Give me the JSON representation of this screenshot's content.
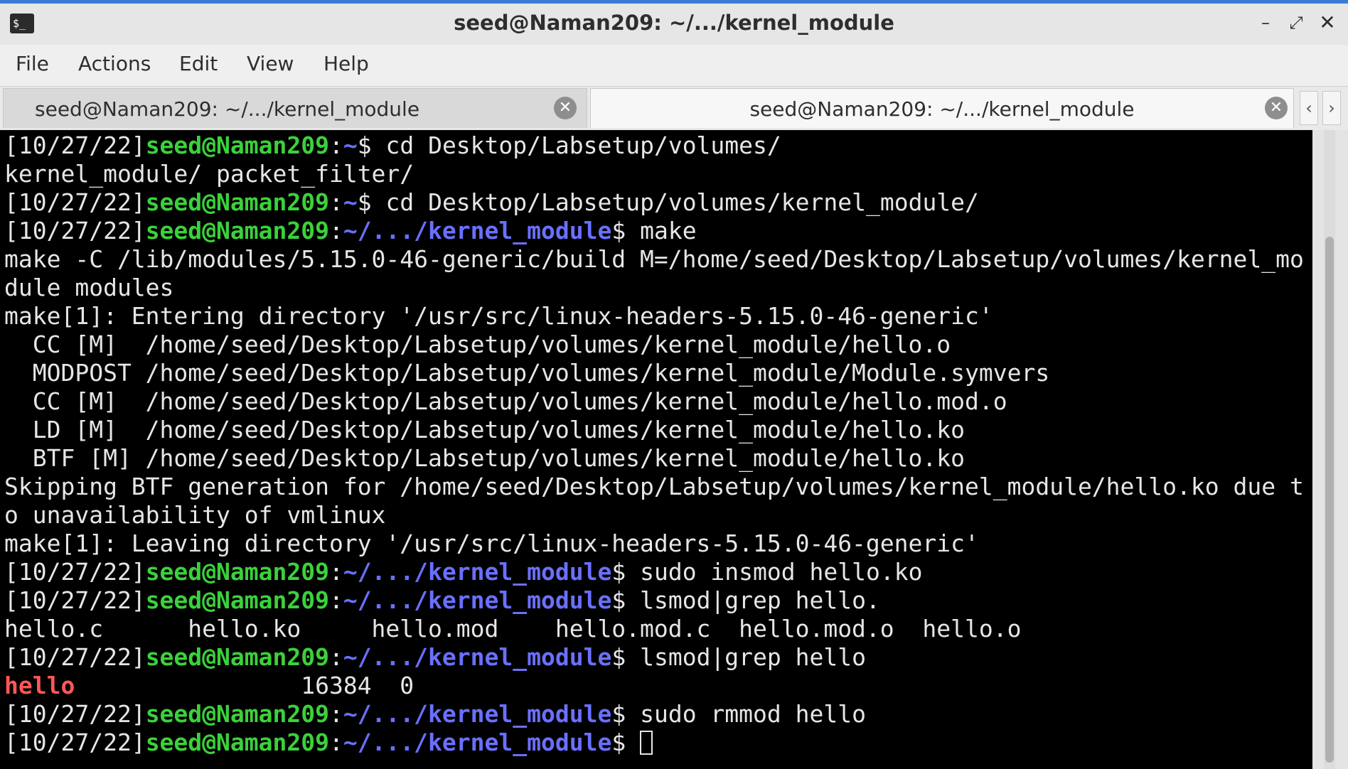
{
  "window": {
    "title": "seed@Naman209: ~/.../kernel_module",
    "app_icon": "$_",
    "controls": {
      "minimize": "–",
      "maximize": "⤢",
      "close": "✕"
    }
  },
  "menu": [
    "File",
    "Actions",
    "Edit",
    "View",
    "Help"
  ],
  "tabs": [
    {
      "label": "seed@Naman209: ~/.../kernel_module",
      "active": false
    },
    {
      "label": "seed@Naman209: ~/.../kernel_module",
      "active": true
    }
  ],
  "tab_nav": {
    "prev": "‹",
    "next": "›"
  },
  "terminal": {
    "prompt": {
      "date": "[10/27/22]",
      "user": "seed@Naman209",
      "home": "~",
      "path": "~/.../kernel_module"
    },
    "lines": [
      {
        "kind": "prompt_home",
        "cmd": "cd Desktop/Labsetup/volumes/"
      },
      {
        "kind": "out",
        "text": "kernel_module/ packet_filter/"
      },
      {
        "kind": "prompt_home",
        "cmd": "cd Desktop/Labsetup/volumes/kernel_module/"
      },
      {
        "kind": "prompt",
        "cmd": "make"
      },
      {
        "kind": "out",
        "text": "make -C /lib/modules/5.15.0-46-generic/build M=/home/seed/Desktop/Labsetup/volumes/kernel_mo"
      },
      {
        "kind": "out",
        "text": "dule modules"
      },
      {
        "kind": "out",
        "text": "make[1]: Entering directory '/usr/src/linux-headers-5.15.0-46-generic'"
      },
      {
        "kind": "out",
        "text": "  CC [M]  /home/seed/Desktop/Labsetup/volumes/kernel_module/hello.o"
      },
      {
        "kind": "out",
        "text": "  MODPOST /home/seed/Desktop/Labsetup/volumes/kernel_module/Module.symvers"
      },
      {
        "kind": "out",
        "text": "  CC [M]  /home/seed/Desktop/Labsetup/volumes/kernel_module/hello.mod.o"
      },
      {
        "kind": "out",
        "text": "  LD [M]  /home/seed/Desktop/Labsetup/volumes/kernel_module/hello.ko"
      },
      {
        "kind": "out",
        "text": "  BTF [M] /home/seed/Desktop/Labsetup/volumes/kernel_module/hello.ko"
      },
      {
        "kind": "out",
        "text": "Skipping BTF generation for /home/seed/Desktop/Labsetup/volumes/kernel_module/hello.ko due t"
      },
      {
        "kind": "out",
        "text": "o unavailability of vmlinux"
      },
      {
        "kind": "out",
        "text": "make[1]: Leaving directory '/usr/src/linux-headers-5.15.0-46-generic'"
      },
      {
        "kind": "prompt",
        "cmd": "sudo insmod hello.ko"
      },
      {
        "kind": "prompt",
        "cmd": "lsmod|grep hello."
      },
      {
        "kind": "out",
        "text": "hello.c      hello.ko     hello.mod    hello.mod.c  hello.mod.o  hello.o"
      },
      {
        "kind": "prompt",
        "cmd": "lsmod|grep hello"
      },
      {
        "kind": "lsmod",
        "name": "hello",
        "rest": "                16384  0"
      },
      {
        "kind": "prompt",
        "cmd": "sudo rmmod hello"
      },
      {
        "kind": "prompt_cursor",
        "cmd": ""
      }
    ]
  }
}
